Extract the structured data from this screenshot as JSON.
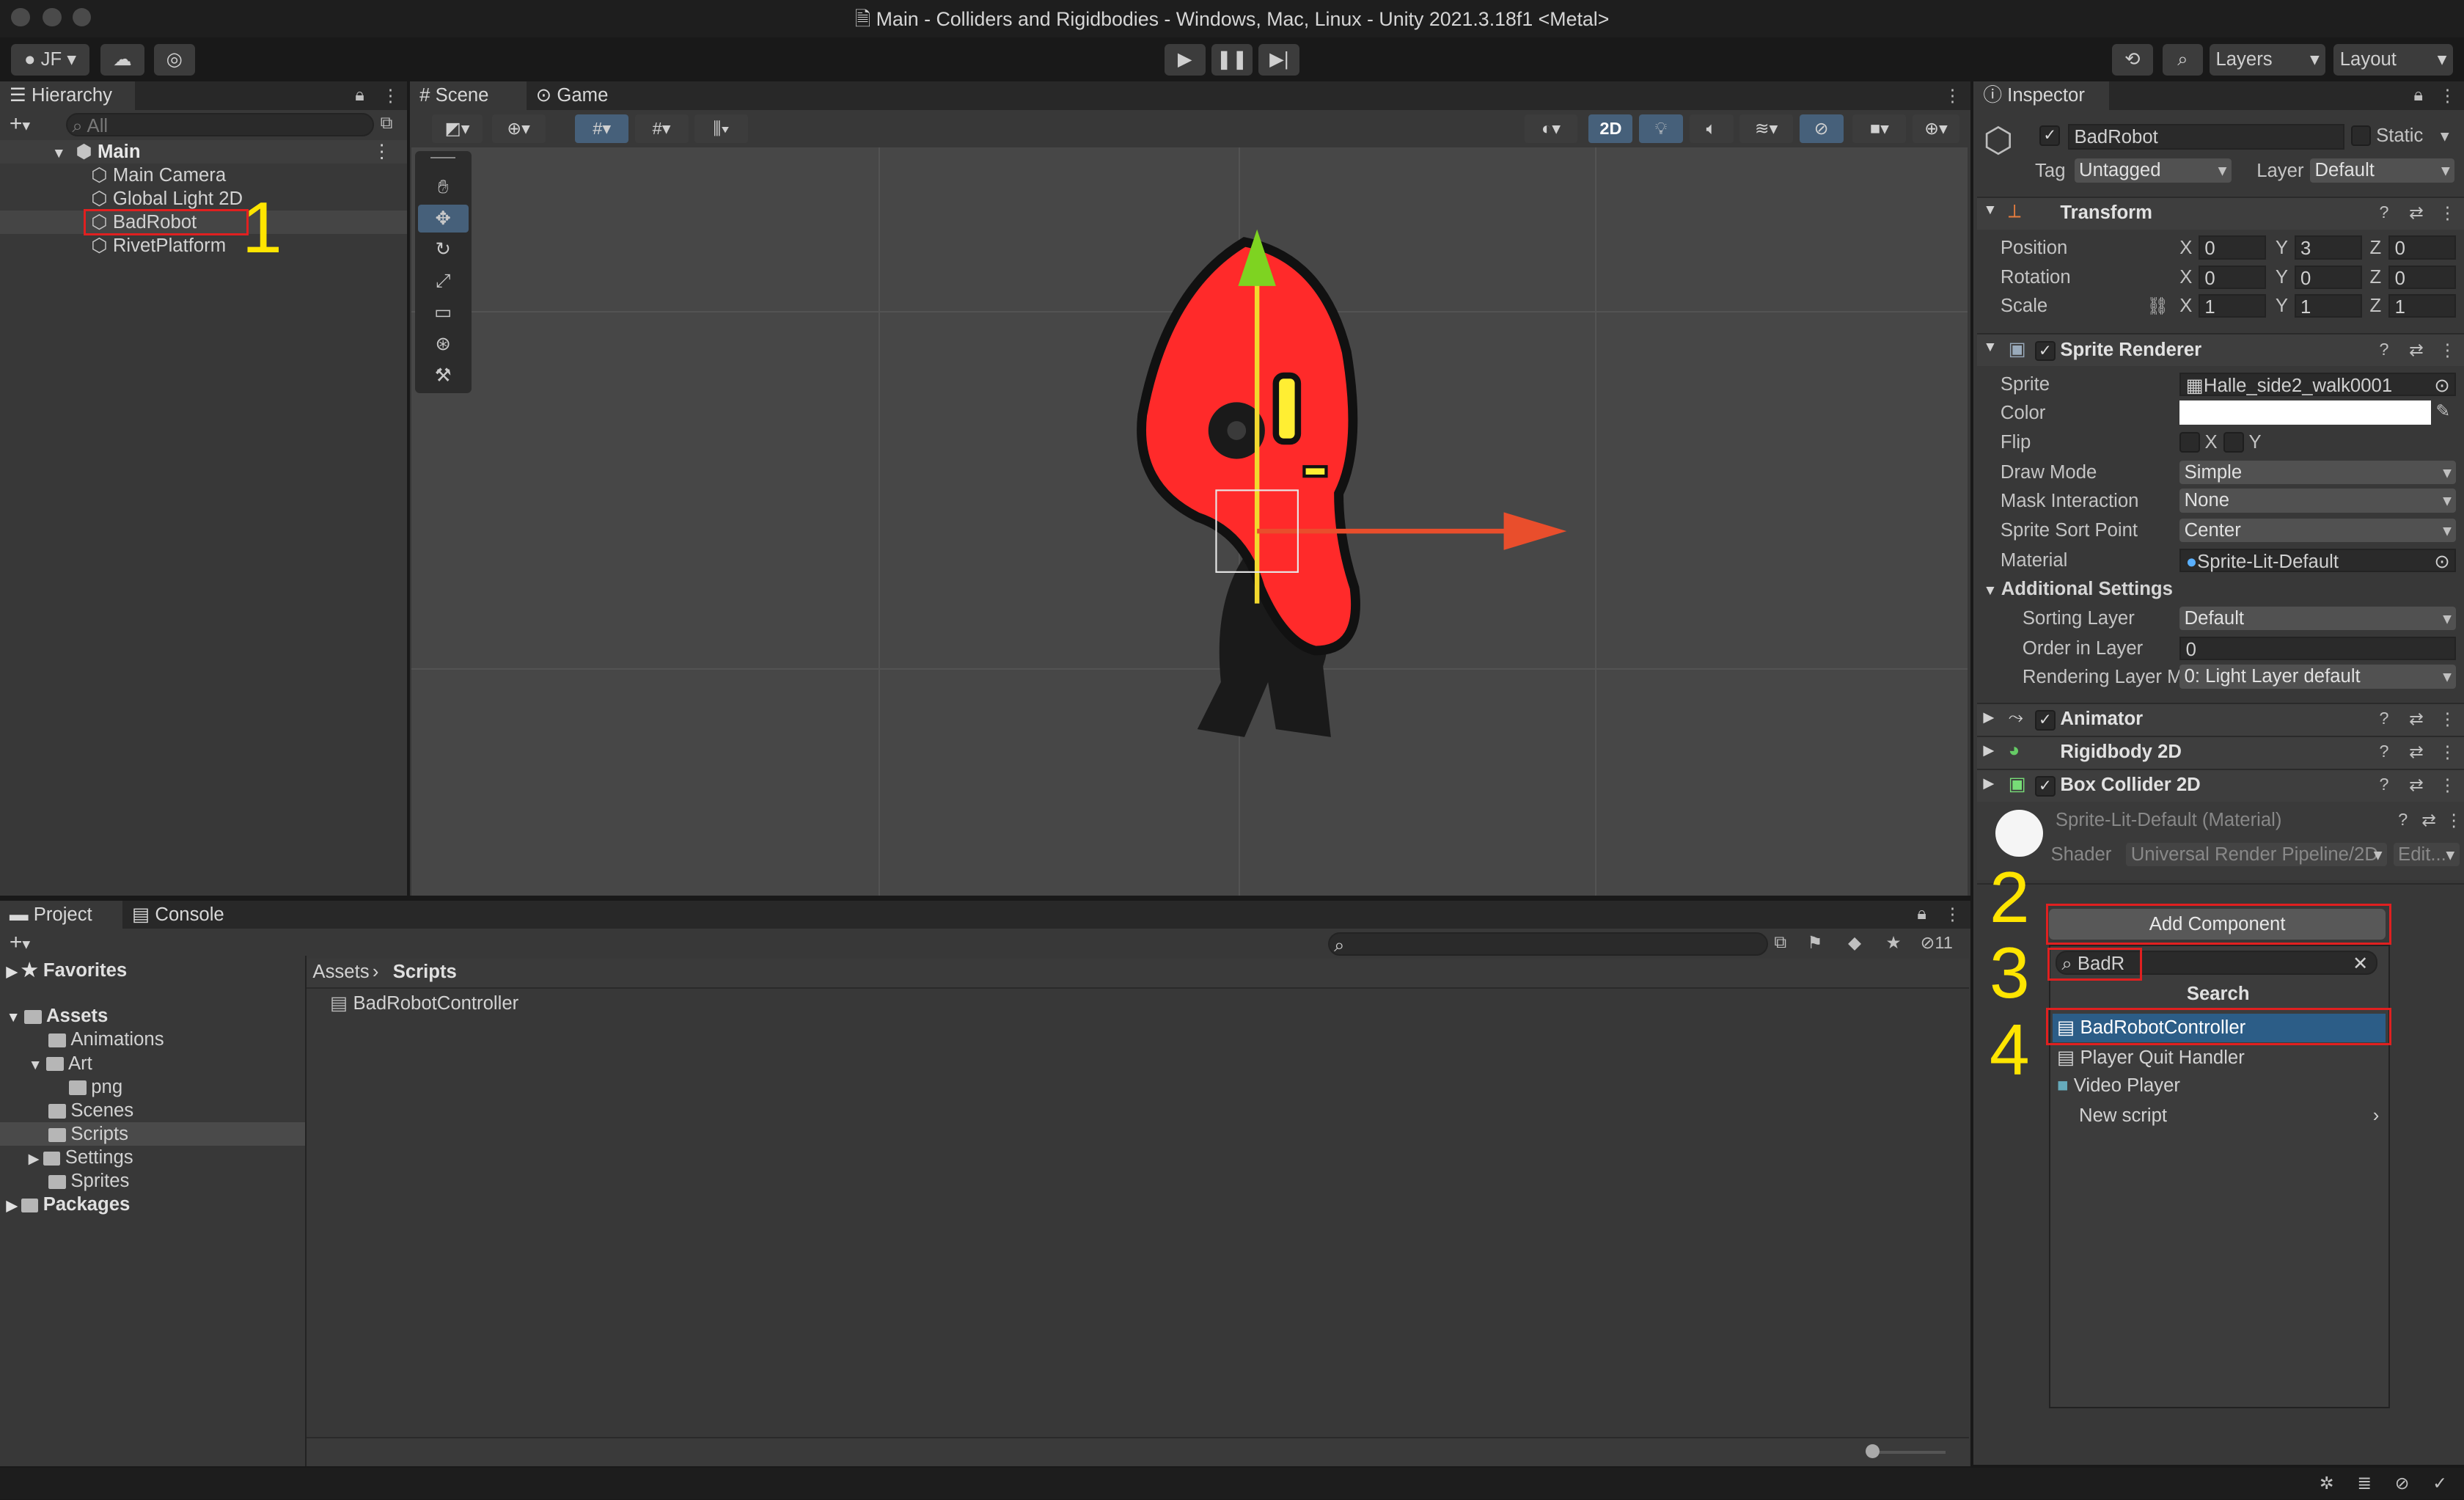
{
  "window": {
    "title": "Main - Colliders and Rigidbodies - Windows, Mac, Linux - Unity 2021.3.18f1 <Metal>"
  },
  "toolbar": {
    "account": "JF",
    "layers": "Layers",
    "layout": "Layout"
  },
  "hierarchy": {
    "tab": "Hierarchy",
    "search_placeholder": "All",
    "scene_name": "Main",
    "items": [
      "Main Camera",
      "Global Light 2D",
      "BadRobot",
      "RivetPlatform"
    ]
  },
  "scene_view": {
    "tabs": [
      "Scene",
      "Game"
    ],
    "mode_2d": "2D"
  },
  "project": {
    "tabs": [
      "Project",
      "Console"
    ],
    "favorites": "Favorites",
    "assets": "Assets",
    "asset_folders": [
      "Animations",
      "Art",
      "png",
      "Scenes",
      "Scripts",
      "Settings",
      "Sprites"
    ],
    "packages": "Packages",
    "breadcrumb": [
      "Assets",
      "Scripts"
    ],
    "files": [
      "BadRobotController"
    ],
    "hidden_count": "11"
  },
  "inspector": {
    "tab": "Inspector",
    "object_name": "BadRobot",
    "static_label": "Static",
    "tag_label": "Tag",
    "tag_value": "Untagged",
    "layer_label": "Layer",
    "layer_value": "Default",
    "transform": {
      "title": "Transform",
      "position_label": "Position",
      "rotation_label": "Rotation",
      "scale_label": "Scale",
      "position": {
        "x": "0",
        "y": "3",
        "z": "0"
      },
      "rotation": {
        "x": "0",
        "y": "0",
        "z": "0"
      },
      "scale": {
        "x": "1",
        "y": "1",
        "z": "1"
      }
    },
    "sprite_renderer": {
      "title": "Sprite Renderer",
      "labels": {
        "sprite": "Sprite",
        "color": "Color",
        "flip": "Flip",
        "draw_mode": "Draw Mode",
        "mask_interaction": "Mask Interaction",
        "sprite_sort_point": "Sprite Sort Point",
        "material": "Material",
        "additional_settings": "Additional Settings",
        "sorting_layer": "Sorting Layer",
        "order_in_layer": "Order in Layer",
        "rendering_layer_mask": "Rendering Layer M"
      },
      "sprite": "Halle_side2_walk0001",
      "color": "#ffffff",
      "flip_x": "X",
      "flip_y": "Y",
      "draw_mode": "Simple",
      "mask_interaction": "None",
      "sprite_sort_point": "Center",
      "material": "Sprite-Lit-Default",
      "sorting_layer": "Default",
      "order_in_layer": "0",
      "rendering_layer_mask": "0: Light Layer default"
    },
    "components": [
      "Animator",
      "Rigidbody 2D",
      "Box Collider 2D"
    ],
    "material_block": {
      "name": "Sprite-Lit-Default (Material)",
      "shader_label": "Shader",
      "shader_value": "Universal Render Pipeline/2D",
      "edit": "Edit..."
    },
    "add_component": "Add Component",
    "search_value": "BadR",
    "search_header": "Search",
    "results": [
      "BadRobotController",
      "Player Quit Handler",
      "Video Player",
      "New script"
    ]
  },
  "annotations": [
    "1",
    "2",
    "3",
    "4"
  ],
  "colors": {
    "accent_selected": "#2c5d87",
    "annotation_yellow": "#ffe500",
    "annotation_red": "#e02020",
    "robot_red": "#ff2a2a"
  }
}
